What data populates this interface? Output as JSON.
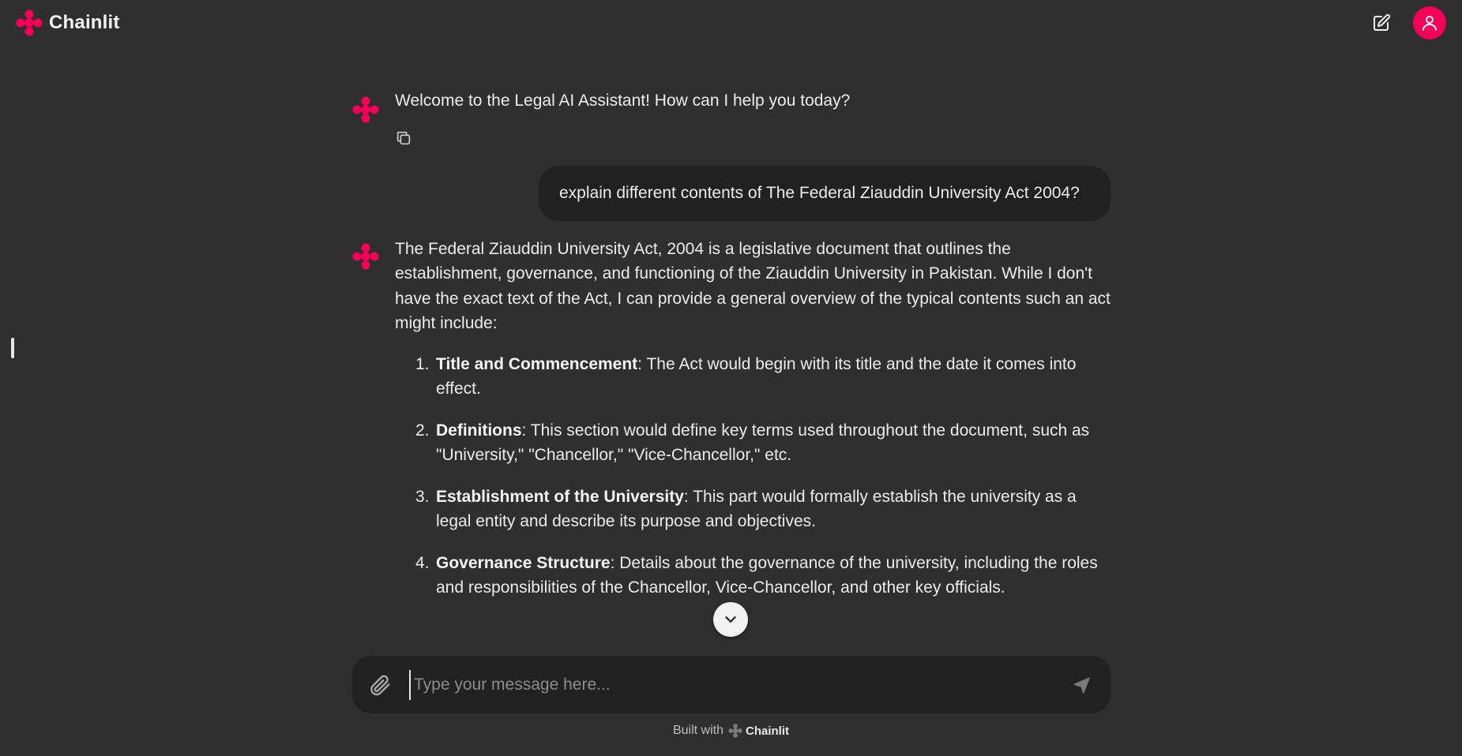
{
  "header": {
    "brand": "Chainlit",
    "new_chat_icon": "edit-icon",
    "user_icon": "user-icon"
  },
  "colors": {
    "accent": "#f50057",
    "background": "#2f2f2f",
    "bubble": "#212121",
    "text": "#ececec"
  },
  "messages": {
    "welcome": "Welcome to the Legal AI Assistant! How can I help you today?",
    "user": "explain different contents of The Federal Ziauddin University Act 2004?",
    "reply_intro": "The Federal Ziauddin University Act, 2004 is a legislative document that outlines the establishment, governance, and functioning of the Ziauddin University in Pakistan. While I don't have the exact text of the Act, I can provide a general overview of the typical contents such an act might include:",
    "points": [
      {
        "num": "1.",
        "title": "Title and Commencement",
        "text": ": The Act would begin with its title and the date it comes into effect."
      },
      {
        "num": "2.",
        "title": "Definitions",
        "text": ": This section would define key terms used throughout the document, such as \"University,\" \"Chancellor,\" \"Vice-Chancellor,\" etc."
      },
      {
        "num": "3.",
        "title": "Establishment of the University",
        "text": ": This part would formally establish the university as a legal entity and describe its purpose and objectives."
      },
      {
        "num": "4.",
        "title": "Governance Structure",
        "text": ": Details about the governance of the university, including the roles and responsibilities of the Chancellor, Vice-Chancellor, and other key officials."
      }
    ]
  },
  "composer": {
    "placeholder": "Type your message here...",
    "value": ""
  },
  "footer": {
    "built_with": "Built with",
    "brand": "Chainlit"
  }
}
